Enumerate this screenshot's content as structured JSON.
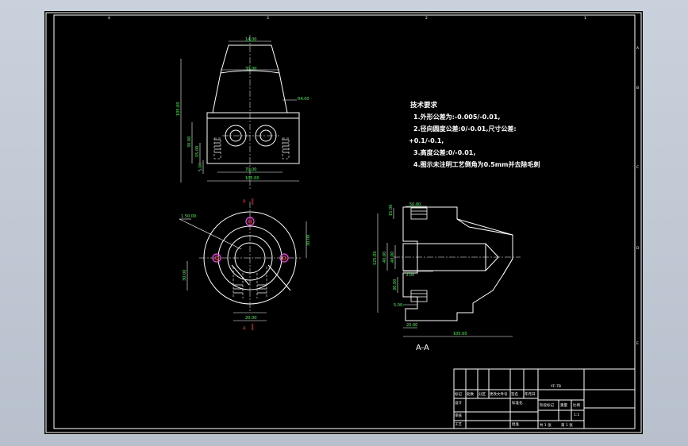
{
  "technical_requirements": {
    "title": "技术要求",
    "items": [
      "1.外形公差为:-0.005/-0.01,",
      "2.径向圆度公差:0/-0.01,尺寸公差:",
      "+0.1/-0.1,",
      "3.高度公差:0/-0.01,",
      "4.图示未注明工艺倒角为0.5mm并去除毛刺"
    ]
  },
  "section_label": "A-A",
  "dimensions": {
    "front": [
      "14.00",
      "30.00",
      "R4.00",
      "105.00",
      "30.00",
      "15.00",
      "5.00",
      "70.00",
      "105.00"
    ],
    "top": [
      "1.50.00",
      "30.00",
      "30.00",
      "20.00",
      "A",
      "A"
    ],
    "section": [
      "15.00",
      "50.00",
      "125.00",
      "40.00",
      "40.00",
      "3.00",
      "30.00",
      "5.00",
      "20.00",
      "105.00"
    ]
  },
  "title_block": {
    "title": "YF-7B",
    "scale": "1:1",
    "sheet_count": "共 1 张",
    "sheet_number": "第 1 张",
    "headers": [
      "标记",
      "处数",
      "分区",
      "更改文件号",
      "签名",
      "年月日"
    ],
    "rows": [
      "设计",
      "审核",
      "工艺"
    ],
    "labels": [
      "标准化",
      "阶段标记",
      "重量",
      "比例",
      "批准"
    ]
  },
  "margin_letters": [
    "A",
    "B",
    "C",
    "D",
    "E"
  ],
  "margin_numbers": [
    "1",
    "2",
    "3",
    "4"
  ]
}
